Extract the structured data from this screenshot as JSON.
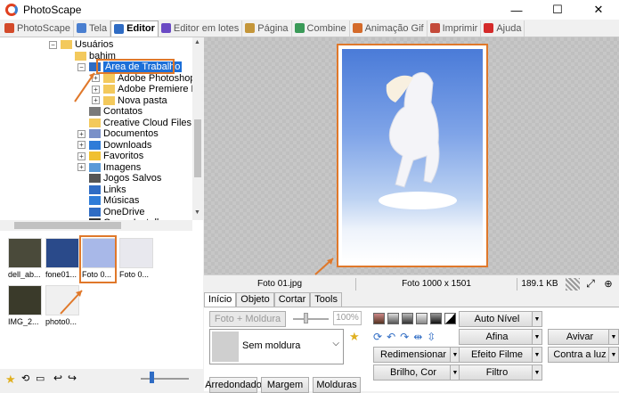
{
  "app": {
    "title": "PhotoScape"
  },
  "window_buttons": {
    "minimize": "—",
    "maximize": "☐",
    "close": "✕"
  },
  "tabs": [
    {
      "label": "PhotoScape",
      "color": "#d34a2a"
    },
    {
      "label": "Tela",
      "color": "#4a7fd0"
    },
    {
      "label": "Editor",
      "color": "#2f6cc4"
    },
    {
      "label": "Editor em lotes",
      "color": "#6a4ac4"
    },
    {
      "label": "Página",
      "color": "#c4963a"
    },
    {
      "label": "Combine",
      "color": "#3a9a58"
    },
    {
      "label": "Animação Gif",
      "color": "#d46a2a"
    },
    {
      "label": "Imprimir",
      "color": "#c44a3a"
    },
    {
      "label": "Ajuda",
      "color": "#d42a2a"
    }
  ],
  "tree": [
    {
      "label": "Usuários",
      "level": 0,
      "expander": "⊟"
    },
    {
      "label": "bahim",
      "level": 1,
      "expander": ""
    },
    {
      "label": "Área de Trabalho",
      "level": 2,
      "expander": "⊟",
      "selected": true
    },
    {
      "label": "Adobe Photoshop",
      "level": 3,
      "expander": "⊞"
    },
    {
      "label": "Adobe Premiere P",
      "level": 3,
      "expander": "⊞"
    },
    {
      "label": "Nova pasta",
      "level": 3,
      "expander": "⊞"
    },
    {
      "label": "Contatos",
      "level": 2,
      "expander": ""
    },
    {
      "label": "Creative Cloud Files",
      "level": 2,
      "expander": ""
    },
    {
      "label": "Documentos",
      "level": 2,
      "expander": "⊞"
    },
    {
      "label": "Downloads",
      "level": 2,
      "expander": "⊞"
    },
    {
      "label": "Favoritos",
      "level": 2,
      "expander": "⊞"
    },
    {
      "label": "Imagens",
      "level": 2,
      "expander": "⊞"
    },
    {
      "label": "Jogos Salvos",
      "level": 2,
      "expander": ""
    },
    {
      "label": "Links",
      "level": 2,
      "expander": ""
    },
    {
      "label": "Músicas",
      "level": 2,
      "expander": ""
    },
    {
      "label": "OneDrive",
      "level": 2,
      "expander": ""
    },
    {
      "label": "Opera Installer",
      "level": 2,
      "expander": ""
    }
  ],
  "thumbnails": [
    {
      "caption": "dell_ab...",
      "color": "#4a4a3a"
    },
    {
      "caption": "fone01...",
      "color": "#2a4a8a"
    },
    {
      "caption": "Foto 0...",
      "color": "#a8b8e8"
    },
    {
      "caption": "Foto 0...",
      "color": "#e8e8ee"
    },
    {
      "caption": "IMG_2...",
      "color": "#3a3a2a"
    },
    {
      "caption": "photo0...",
      "color": "#f0f0f0"
    }
  ],
  "status": {
    "filename": "Foto 01.jpg",
    "dimensions": "Foto 1000 x 1501",
    "filesize": "189.1 KB"
  },
  "panel": {
    "tabs": [
      "Início",
      "Objeto",
      "Cortar",
      "Tools"
    ],
    "foto_moldura": "Foto + Moldura",
    "opacity": "100%",
    "frame_select": "Sem moldura",
    "arredondado": "Arredondado",
    "margem": "Margem",
    "molduras": "Molduras",
    "auto_nivel": "Auto Nível",
    "afina": "Afina",
    "avivar": "Avivar",
    "redimensionar": "Redimensionar",
    "efeito_filme": "Efeito Filme",
    "contra_luz": "Contra a luz",
    "brilho_cor": "Brilho, Cor",
    "filtro": "Filtro"
  },
  "colors": {
    "accent": "#e0782a",
    "selection": "#1c6fd8"
  }
}
